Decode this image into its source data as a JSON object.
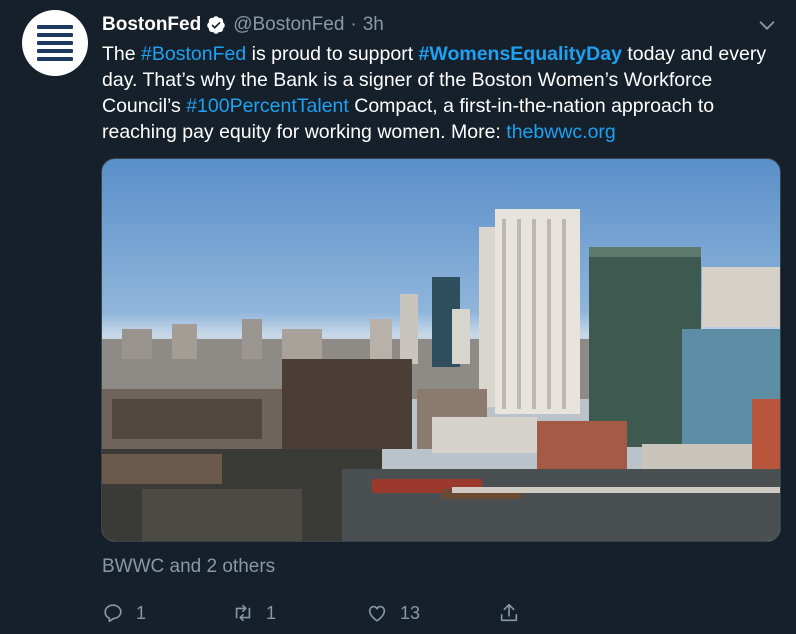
{
  "tweet": {
    "author_name": "BostonFed",
    "handle": "@BostonFed",
    "separator": "·",
    "time": "3h",
    "text": {
      "p1": "The ",
      "hashtag1": "#BostonFed",
      "p2": " is proud to support ",
      "hashtag2": "#WomensEqualityDay",
      "p3": " today and every day. That’s why the Bank is a signer of the Boston Women’s Workforce Council’s ",
      "hashtag3": "#100PercentTalent",
      "p4": " Compact, a first-in-the-nation approach to reaching pay equity for working women. More: ",
      "link": "thebwwc.org"
    },
    "likers": "BWWC and 2 others",
    "actions": {
      "reply_count": "1",
      "retweet_count": "1",
      "like_count": "13"
    }
  },
  "colors": {
    "background": "#15202b",
    "accent": "#1da1f2",
    "secondary_text": "#8899a6"
  },
  "icons": [
    "logo-avatar",
    "verified-badge-icon",
    "chevron-down-icon",
    "reply-icon",
    "retweet-icon",
    "like-icon",
    "share-icon"
  ]
}
